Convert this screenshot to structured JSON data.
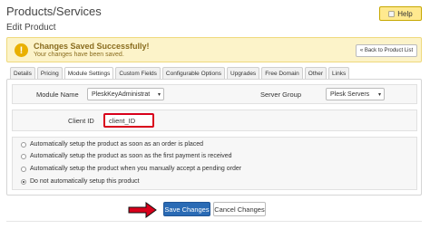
{
  "page": {
    "title": "Products/Services",
    "subtitle": "Edit Product",
    "help_label": "Help"
  },
  "alert": {
    "title": "Changes Saved Successfully!",
    "message": "Your changes have been saved.",
    "back_label": "« Back to Product List",
    "icon": "warning-icon",
    "color": "#fcf3c9"
  },
  "tabs": [
    {
      "label": "Details",
      "active": false
    },
    {
      "label": "Pricing",
      "active": false
    },
    {
      "label": "Module Settings",
      "active": true
    },
    {
      "label": "Custom Fields",
      "active": false
    },
    {
      "label": "Configurable Options",
      "active": false
    },
    {
      "label": "Upgrades",
      "active": false
    },
    {
      "label": "Free Domain",
      "active": false
    },
    {
      "label": "Other",
      "active": false
    },
    {
      "label": "Links",
      "active": false
    }
  ],
  "module": {
    "module_name_label": "Module Name",
    "module_name_value": "PleskKeyAdministrat",
    "server_group_label": "Server Group",
    "server_group_value": "Plesk Servers",
    "client_id_label": "Client ID",
    "client_id_value": "client_ID"
  },
  "setup_options": [
    {
      "label": "Automatically setup the product as soon as an order is placed",
      "checked": false
    },
    {
      "label": "Automatically setup the product as soon as the first payment is received",
      "checked": false
    },
    {
      "label": "Automatically setup the product when you manually accept a pending order",
      "checked": false
    },
    {
      "label": "Do not automatically setup this product",
      "checked": true
    }
  ],
  "actions": {
    "save_label": "Save Changes",
    "cancel_label": "Cancel Changes",
    "accent": "#2a6bb5",
    "highlight": "#d9001b"
  }
}
